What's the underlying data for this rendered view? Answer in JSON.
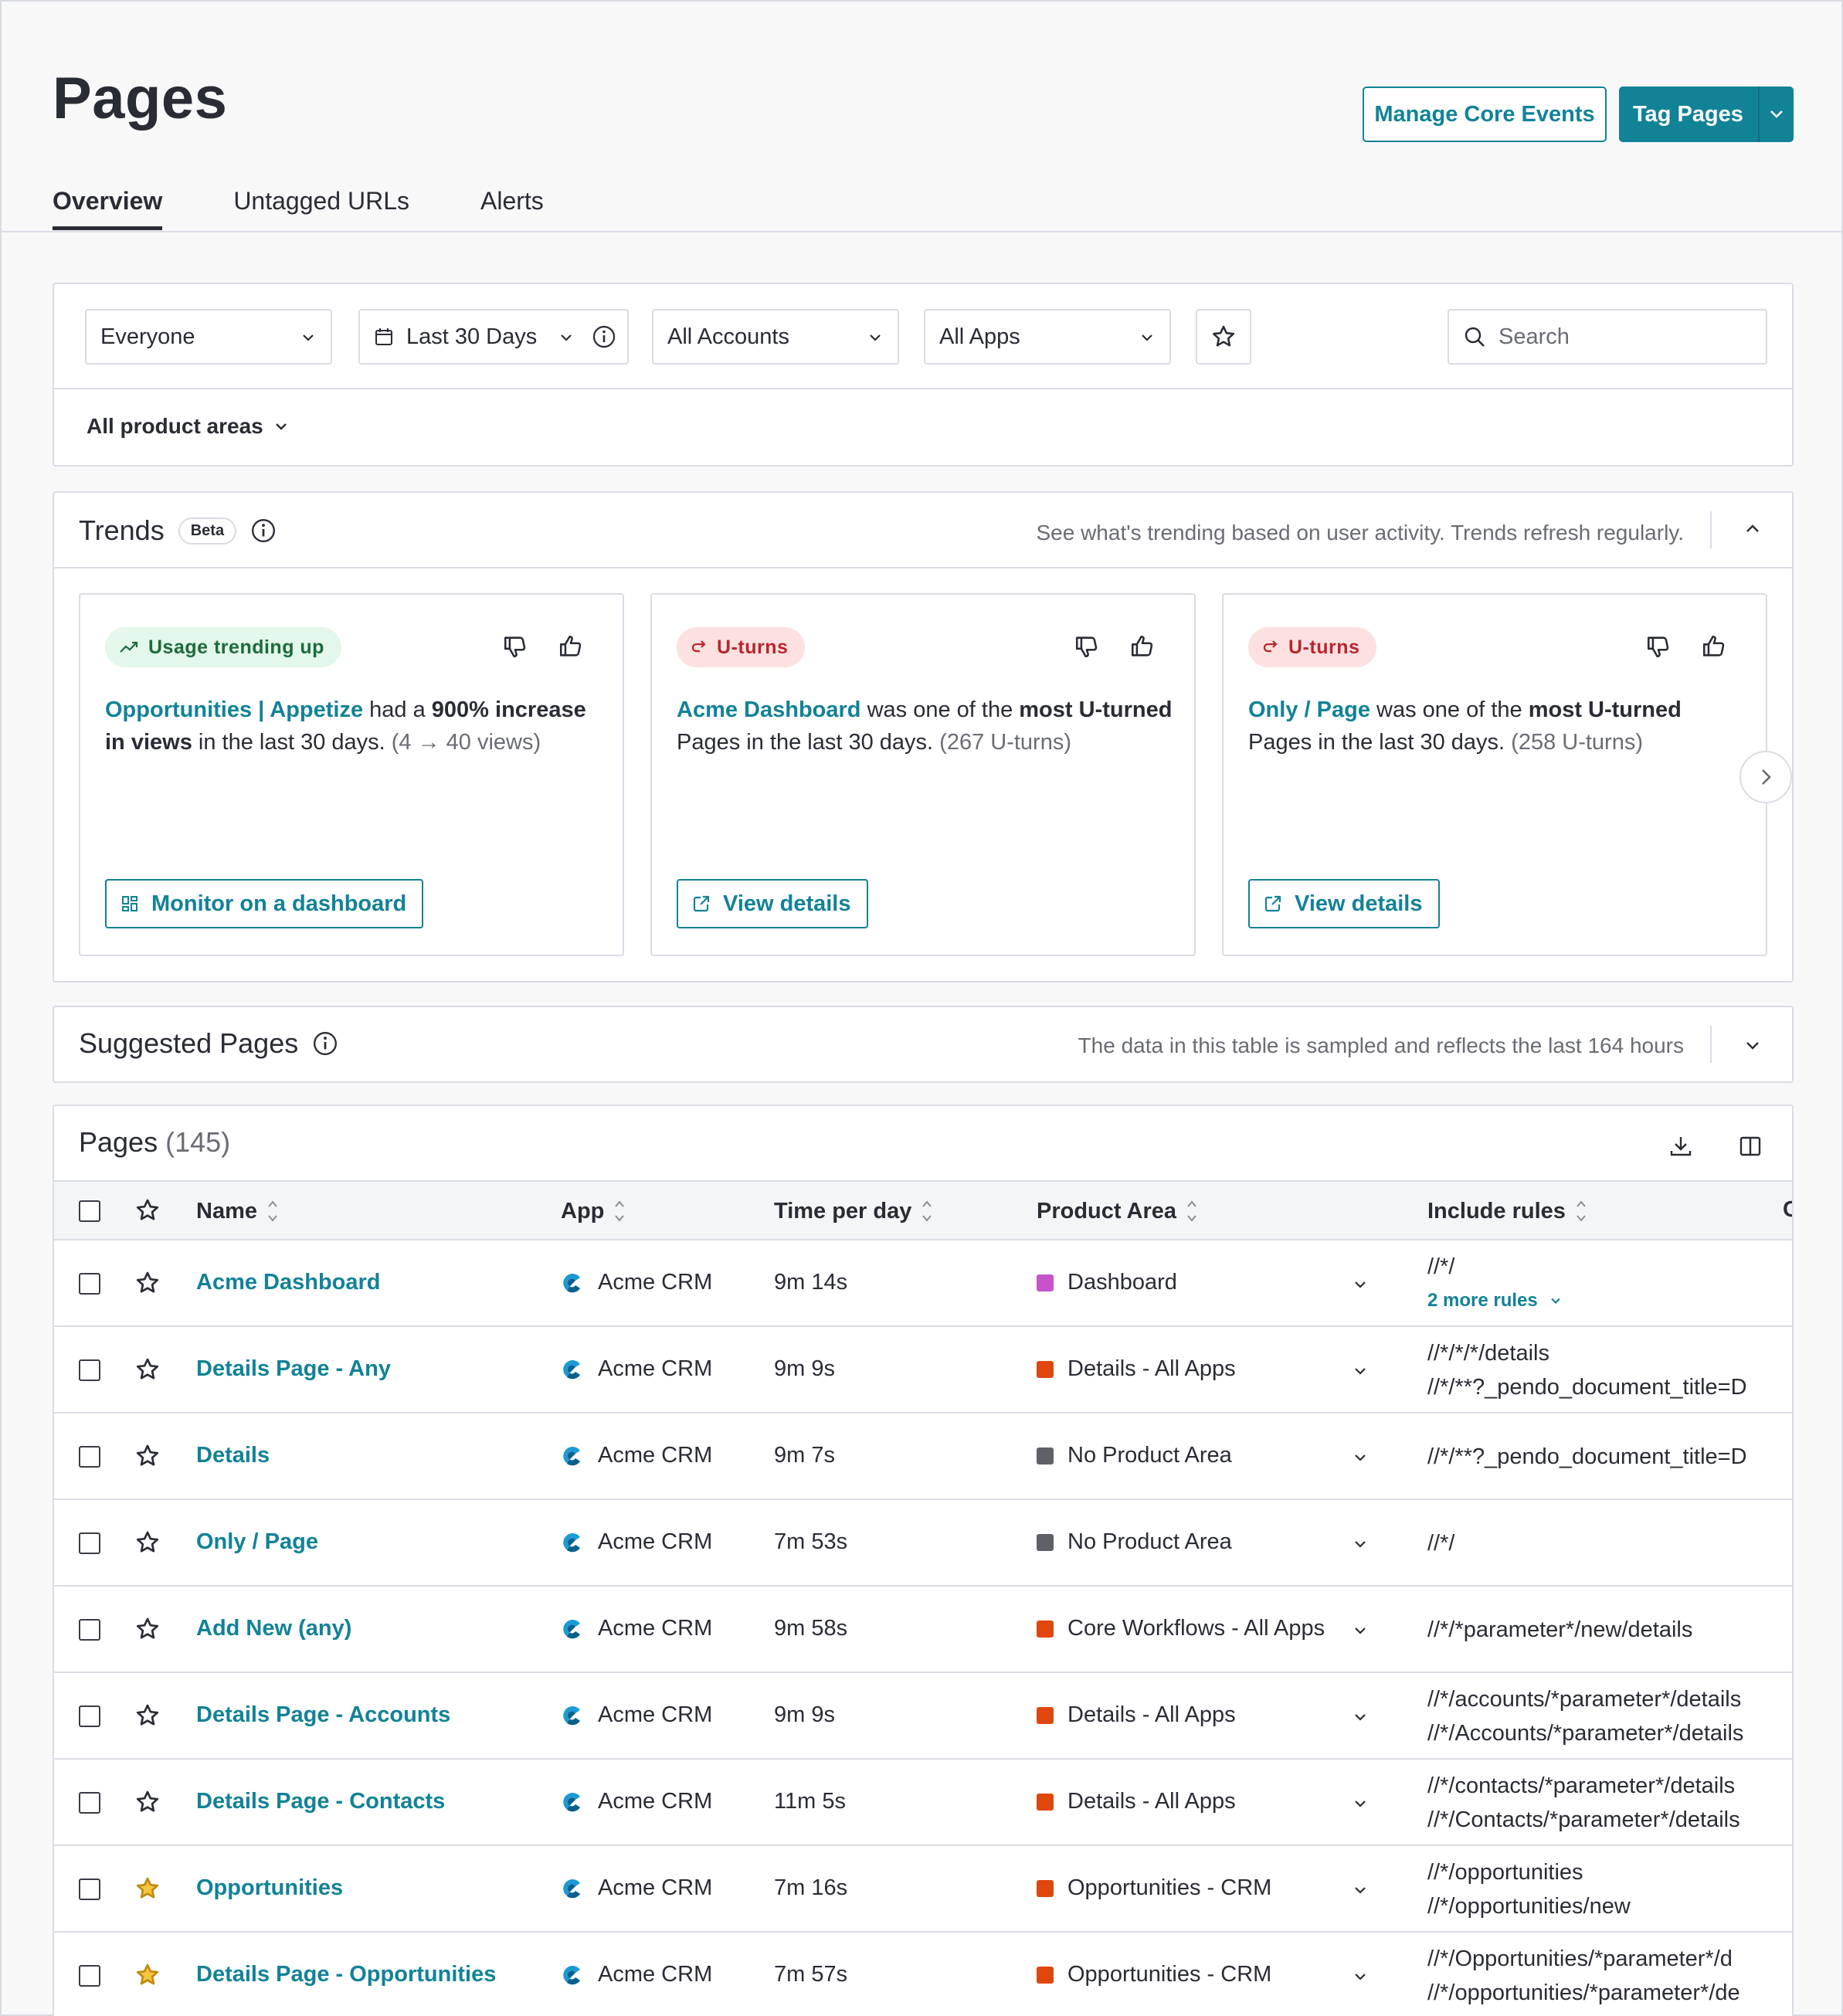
{
  "header": {
    "title": "Pages",
    "manage_core_events": "Manage Core Events",
    "tag_pages": "Tag Pages"
  },
  "tabs": [
    {
      "label": "Overview",
      "active": true
    },
    {
      "label": "Untagged URLs",
      "active": false
    },
    {
      "label": "Alerts",
      "active": false
    }
  ],
  "filters": {
    "segment": "Everyone",
    "date_range": "Last 30 Days",
    "accounts": "All Accounts",
    "apps": "All Apps",
    "search_placeholder": "Search",
    "product_areas": "All product areas"
  },
  "trends": {
    "title": "Trends",
    "badge": "Beta",
    "note": "See what's trending based on user activity. Trends refresh regularly.",
    "cards": [
      {
        "pill": "Usage trending up",
        "link": "Opportunities | Appetize",
        "t1": " had a ",
        "b1": "900% increase in views",
        "t2": " in the last 30 days. ",
        "muted": "(4 → 40 views)",
        "button": "Monitor on a dashboard"
      },
      {
        "pill": "U-turns",
        "link": "Acme Dashboard",
        "t1": " was one of the ",
        "b1": "most U-turned",
        "t2": " Pages in the last 30 days. ",
        "muted": "(267 U-turns)",
        "button": "View details"
      },
      {
        "pill": "U-turns",
        "link": "Only / Page",
        "t1": " was one of the ",
        "b1": "most U-turned",
        "t2": " Pages in the last 30 days. ",
        "muted": "(258 U-turns)",
        "button": "View details"
      }
    ]
  },
  "suggested": {
    "title": "Suggested Pages",
    "note": "The data in this table is sampled and reflects the last 164 hours"
  },
  "pages_table": {
    "title": "Pages",
    "count": "(145)",
    "columns": [
      "Name",
      "App",
      "Time per day",
      "Product Area",
      "Include rules",
      "C"
    ],
    "rows": [
      {
        "name": "Acme Dashboard",
        "app": "Acme CRM",
        "time": "9m 14s",
        "area": "Dashboard",
        "area_color": "#c653c9",
        "rules": [
          "//*/"
        ],
        "more": "2 more rules",
        "starred": false
      },
      {
        "name": "Details Page - Any",
        "app": "Acme CRM",
        "time": "9m 9s",
        "area": "Details - All Apps",
        "area_color": "#e0470e",
        "rules": [
          "//*/*/*/details",
          "//*/**?_pendo_document_title=D"
        ],
        "starred": false
      },
      {
        "name": "Details",
        "app": "Acme CRM",
        "time": "9m 7s",
        "area": "No Product Area",
        "area_color": "#5f6068",
        "rules": [
          "//*/**?_pendo_document_title=D"
        ],
        "starred": false
      },
      {
        "name": "Only / Page",
        "app": "Acme CRM",
        "time": "7m 53s",
        "area": "No Product Area",
        "area_color": "#5f6068",
        "rules": [
          "//*/"
        ],
        "starred": false
      },
      {
        "name": "Add New (any)",
        "app": "Acme CRM",
        "time": "9m 58s",
        "area": "Core Workflows - All Apps",
        "area_color": "#e0470e",
        "rules": [
          "//*/*parameter*/new/details"
        ],
        "starred": false
      },
      {
        "name": "Details Page - Accounts",
        "app": "Acme CRM",
        "time": "9m 9s",
        "area": "Details - All Apps",
        "area_color": "#e0470e",
        "rules": [
          "//*/accounts/*parameter*/details",
          "//*/Accounts/*parameter*/details"
        ],
        "starred": false
      },
      {
        "name": "Details Page - Contacts",
        "app": "Acme CRM",
        "time": "11m 5s",
        "area": "Details - All Apps",
        "area_color": "#e0470e",
        "rules": [
          "//*/contacts/*parameter*/details",
          "//*/Contacts/*parameter*/details"
        ],
        "starred": false
      },
      {
        "name": "Opportunities",
        "app": "Acme CRM",
        "time": "7m 16s",
        "area": "Opportunities - CRM",
        "area_color": "#e0470e",
        "rules": [
          "//*/opportunities",
          "//*/opportunities/new"
        ],
        "starred": true
      },
      {
        "name": "Details Page - Opportunities",
        "app": "Acme CRM",
        "time": "7m 57s",
        "area": "Opportunities - CRM",
        "area_color": "#e0470e",
        "rules": [
          "//*/Opportunities/*parameter*/d",
          "//*/opportunities/*parameter*/de"
        ],
        "starred": true
      }
    ]
  }
}
